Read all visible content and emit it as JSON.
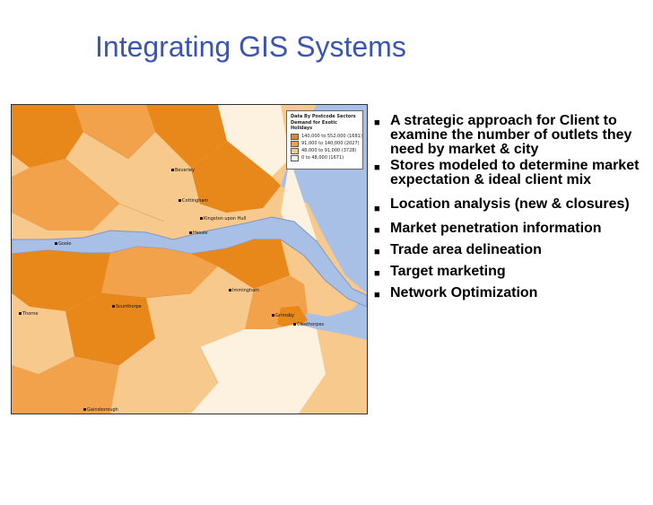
{
  "slide": {
    "title": "Integrating GIS Systems"
  },
  "map": {
    "legend": {
      "title": "Data By Postcode Sectors",
      "subtitle": "Demand for Exotic Holidays",
      "entries": [
        {
          "label": "140,000 to 552,000   (1681)",
          "color": "#e8871a"
        },
        {
          "label": "91,000 to 140,000   (2027)",
          "color": "#f2a24a"
        },
        {
          "label": "48,000 to 91,000   (3728)",
          "color": "#f8c98c"
        },
        {
          "label": "0 to 48,000   (1671)",
          "color": "#fdf2e0"
        }
      ]
    },
    "towns": [
      "Beverley",
      "Cottingham",
      "Kingston upon Hull",
      "Hessle",
      "Goole",
      "Thorne",
      "Scunthorpe",
      "Immingham",
      "Grimsby",
      "Cleethorpes",
      "Gainsborough"
    ],
    "colors": {
      "sea": "#a9c0e6",
      "land_high": "#e8871a",
      "land_mid": "#f2a24a",
      "land_low": "#f8c98c",
      "land_none": "#fdf2e0"
    }
  },
  "bullets": [
    {
      "text": "A strategic approach for Client to examine the number of outlets they need by market & city"
    },
    {
      "text": "Stores modeled to determine market expectation & ideal client mix"
    },
    {
      "text": "Location analysis (new & closures)"
    },
    {
      "text": "Market penetration information"
    },
    {
      "text": "Trade area delineation"
    },
    {
      "text": "Target marketing"
    },
    {
      "text": "Network Optimization"
    }
  ]
}
